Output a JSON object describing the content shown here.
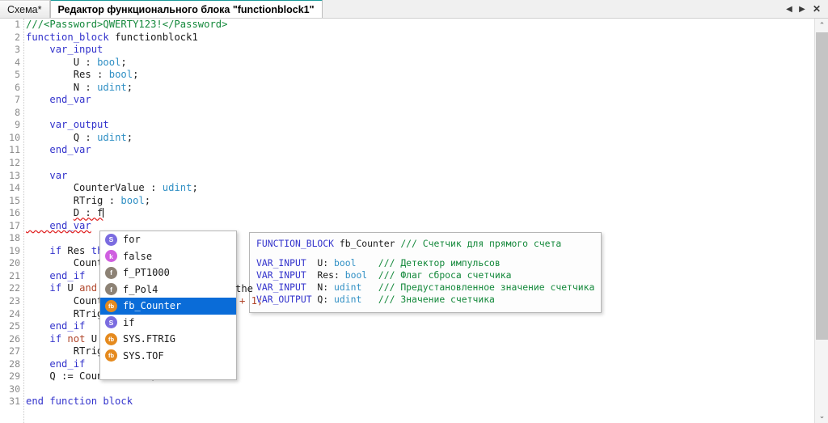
{
  "tabs": [
    {
      "label": "Схема*",
      "active": false
    },
    {
      "label": "Редактор функционального блока \"functionblock1\"",
      "active": true
    }
  ],
  "tab_controls": {
    "prev": "◀",
    "next": "▶",
    "close": "✕"
  },
  "scrollbar": {
    "up": "⌃",
    "down": "⌄"
  },
  "code": {
    "language": "ST / IEC 61131-3",
    "lines": [
      {
        "n": "1",
        "segs": [
          {
            "t": "///<Password>QWERTY123!</Password>",
            "c": "cmt"
          }
        ]
      },
      {
        "n": "2",
        "segs": [
          {
            "t": "function_block",
            "c": "kw"
          },
          {
            "t": " functionblock1",
            "c": ""
          }
        ]
      },
      {
        "n": "3",
        "segs": [
          {
            "t": "    ",
            "c": ""
          },
          {
            "t": "var_input",
            "c": "kw"
          }
        ]
      },
      {
        "n": "4",
        "segs": [
          {
            "t": "        U : ",
            "c": ""
          },
          {
            "t": "bool",
            "c": "typ"
          },
          {
            "t": ";",
            "c": ""
          }
        ]
      },
      {
        "n": "5",
        "segs": [
          {
            "t": "        Res : ",
            "c": ""
          },
          {
            "t": "bool",
            "c": "typ"
          },
          {
            "t": ";",
            "c": ""
          }
        ]
      },
      {
        "n": "6",
        "segs": [
          {
            "t": "        N : ",
            "c": ""
          },
          {
            "t": "udint",
            "c": "typ"
          },
          {
            "t": ";",
            "c": ""
          }
        ]
      },
      {
        "n": "7",
        "segs": [
          {
            "t": "    ",
            "c": ""
          },
          {
            "t": "end_var",
            "c": "kw"
          }
        ]
      },
      {
        "n": "8",
        "segs": []
      },
      {
        "n": "9",
        "segs": [
          {
            "t": "    ",
            "c": ""
          },
          {
            "t": "var_output",
            "c": "kw"
          }
        ]
      },
      {
        "n": "10",
        "segs": [
          {
            "t": "        Q : ",
            "c": ""
          },
          {
            "t": "udint",
            "c": "typ"
          },
          {
            "t": ";",
            "c": ""
          }
        ]
      },
      {
        "n": "11",
        "segs": [
          {
            "t": "    ",
            "c": ""
          },
          {
            "t": "end_var",
            "c": "kw"
          }
        ]
      },
      {
        "n": "12",
        "segs": []
      },
      {
        "n": "13",
        "segs": [
          {
            "t": "    ",
            "c": ""
          },
          {
            "t": "var",
            "c": "kw"
          }
        ]
      },
      {
        "n": "14",
        "segs": [
          {
            "t": "        CounterValue : ",
            "c": ""
          },
          {
            "t": "udint",
            "c": "typ"
          },
          {
            "t": ";",
            "c": ""
          }
        ]
      },
      {
        "n": "15",
        "segs": [
          {
            "t": "        RTrig : ",
            "c": ""
          },
          {
            "t": "bool",
            "c": "typ"
          },
          {
            "t": ";",
            "c": ""
          }
        ]
      },
      {
        "n": "16",
        "segs": [
          {
            "t": "        ",
            "c": ""
          },
          {
            "t": "D : f",
            "c": "sq"
          }
        ],
        "caret": true
      },
      {
        "n": "17",
        "segs": [
          {
            "t": "    end_var",
            "c": "kw sq"
          }
        ]
      },
      {
        "n": "18",
        "segs": []
      },
      {
        "n": "19",
        "segs": [
          {
            "t": "    ",
            "c": ""
          },
          {
            "t": "if",
            "c": "kw"
          },
          {
            "t": " Res ",
            "c": ""
          },
          {
            "t": "th",
            "c": "kw"
          }
        ]
      },
      {
        "n": "20",
        "segs": [
          {
            "t": "        Counte",
            "c": ""
          }
        ]
      },
      {
        "n": "21",
        "segs": [
          {
            "t": "    ",
            "c": ""
          },
          {
            "t": "end_if",
            "c": "kw"
          }
        ]
      },
      {
        "n": "22",
        "segs": [
          {
            "t": "    ",
            "c": ""
          },
          {
            "t": "if",
            "c": "kw"
          },
          {
            "t": " U ",
            "c": ""
          },
          {
            "t": "and",
            "c": "op"
          }
        ]
      },
      {
        "n": "23",
        "segs": [
          {
            "t": "        Counte",
            "c": ""
          }
        ]
      },
      {
        "n": "24",
        "segs": [
          {
            "t": "        RTrig",
            "c": ""
          }
        ]
      },
      {
        "n": "25",
        "segs": [
          {
            "t": "    ",
            "c": ""
          },
          {
            "t": "end_if",
            "c": "kw"
          }
        ]
      },
      {
        "n": "26",
        "segs": [
          {
            "t": "    ",
            "c": ""
          },
          {
            "t": "if",
            "c": "kw"
          },
          {
            "t": " ",
            "c": ""
          },
          {
            "t": "not",
            "c": "op"
          },
          {
            "t": " U",
            "c": ""
          }
        ]
      },
      {
        "n": "27",
        "segs": [
          {
            "t": "        RTrig",
            "c": ""
          }
        ]
      },
      {
        "n": "28",
        "segs": [
          {
            "t": "    ",
            "c": ""
          },
          {
            "t": "end_if",
            "c": "kw"
          }
        ]
      },
      {
        "n": "29",
        "segs": [
          {
            "t": "    Q := CounterValue;",
            "c": ""
          }
        ]
      },
      {
        "n": "30",
        "segs": []
      },
      {
        "n": "31",
        "segs": [
          {
            "t": "end function block",
            "c": "kw"
          }
        ]
      }
    ],
    "occluded_fragments": [
      {
        "line": "22",
        "text": "the"
      },
      {
        "line": "23",
        "text": "+ 1;"
      }
    ]
  },
  "autocomplete": {
    "selected_index": 4,
    "items": [
      {
        "label": "for",
        "badge": "S",
        "kind": "snippet"
      },
      {
        "label": "false",
        "badge": "k",
        "kind": "keyword"
      },
      {
        "label": "f_PT1000",
        "badge": "f",
        "kind": "function"
      },
      {
        "label": "f_Pol4",
        "badge": "f",
        "kind": "function"
      },
      {
        "label": "fb_Counter",
        "badge": "fb",
        "kind": "function-block"
      },
      {
        "label": "if",
        "badge": "S",
        "kind": "snippet"
      },
      {
        "label": "SYS.FTRIG",
        "badge": "fb",
        "kind": "function-block"
      },
      {
        "label": "SYS.TOF",
        "badge": "fb",
        "kind": "function-block"
      }
    ]
  },
  "signature_tooltip": {
    "header": [
      {
        "t": "FUNCTION_BLOCK",
        "c": "kw"
      },
      {
        "t": " fb_Counter ",
        "c": ""
      },
      {
        "t": "/// Счетчик для прямого счета",
        "c": "cmt"
      }
    ],
    "params": [
      [
        {
          "t": "VAR_INPUT ",
          "c": "kw"
        },
        {
          "t": " U: ",
          "c": ""
        },
        {
          "t": "bool",
          "c": "typ"
        },
        {
          "t": "    ",
          "c": ""
        },
        {
          "t": "/// Детектор импульсов",
          "c": "cmt"
        }
      ],
      [
        {
          "t": "VAR_INPUT ",
          "c": "kw"
        },
        {
          "t": " Res: ",
          "c": ""
        },
        {
          "t": "bool",
          "c": "typ"
        },
        {
          "t": "  ",
          "c": ""
        },
        {
          "t": "/// Флаг сброса счетчика",
          "c": "cmt"
        }
      ],
      [
        {
          "t": "VAR_INPUT ",
          "c": "kw"
        },
        {
          "t": " N: ",
          "c": ""
        },
        {
          "t": "udint",
          "c": "typ"
        },
        {
          "t": "   ",
          "c": ""
        },
        {
          "t": "/// Предустановленное значение счетчика",
          "c": "cmt"
        }
      ],
      [
        {
          "t": "VAR_OUTPUT",
          "c": "kw"
        },
        {
          "t": " Q: ",
          "c": ""
        },
        {
          "t": "udint",
          "c": "typ"
        },
        {
          "t": "   ",
          "c": ""
        },
        {
          "t": "/// Значение счетчика",
          "c": "cmt"
        }
      ]
    ]
  },
  "colors": {
    "keyword": "#3333cc",
    "type": "#2f8fc4",
    "comment": "#13883a",
    "operator": "#b0452a",
    "selection": "#0a6cd8",
    "active_tab_accent": "#1a9a9a",
    "error_squiggle": "#e02020",
    "badge_snippet": "#7b6ce0",
    "badge_keyword": "#cf5fe0",
    "badge_function": "#8d8275",
    "badge_function_block": "#e58a1e"
  }
}
